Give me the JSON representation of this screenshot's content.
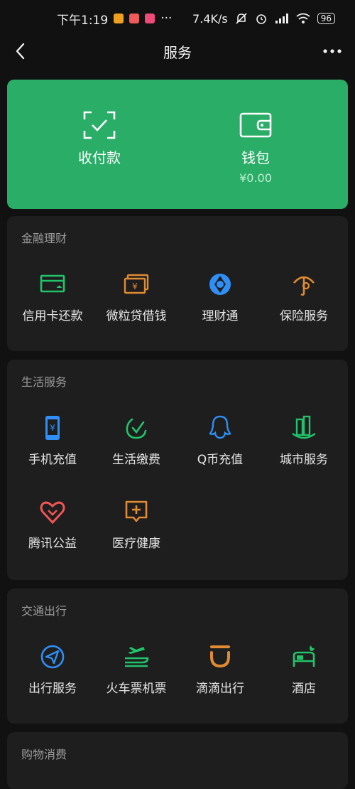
{
  "status_bar": {
    "time": "下午1:19",
    "network_speed": "7.4K/s",
    "battery": "96",
    "more": "···"
  },
  "header": {
    "title": "服务"
  },
  "wallet_card": {
    "pay": {
      "label": "收付款",
      "icon": "scan-check-icon"
    },
    "wallet": {
      "label": "钱包",
      "balance": "¥0.00",
      "icon": "wallet-icon"
    }
  },
  "sections": {
    "finance": {
      "title": "金融理财",
      "items": [
        {
          "label": "信用卡还款",
          "icon": "credit-card-icon"
        },
        {
          "label": "微粒贷借钱",
          "icon": "cash-icon"
        },
        {
          "label": "理财通",
          "icon": "wealth-icon"
        },
        {
          "label": "保险服务",
          "icon": "insurance-icon"
        }
      ]
    },
    "life": {
      "title": "生活服务",
      "items": [
        {
          "label": "手机充值",
          "icon": "phone-icon"
        },
        {
          "label": "生活缴费",
          "icon": "utility-icon"
        },
        {
          "label": "Q币充值",
          "icon": "qq-icon"
        },
        {
          "label": "城市服务",
          "icon": "city-icon"
        },
        {
          "label": "腾讯公益",
          "icon": "charity-icon"
        },
        {
          "label": "医疗健康",
          "icon": "medical-icon"
        }
      ]
    },
    "travel": {
      "title": "交通出行",
      "items": [
        {
          "label": "出行服务",
          "icon": "navigation-icon"
        },
        {
          "label": "火车票机票",
          "icon": "train-icon"
        },
        {
          "label": "滴滴出行",
          "icon": "didi-icon"
        },
        {
          "label": "酒店",
          "icon": "hotel-icon"
        }
      ]
    },
    "shopping": {
      "title": "购物消费"
    }
  },
  "colors": {
    "green_card": "#2aae67",
    "green_icon": "#21c46a",
    "blue_icon": "#2f8ff5",
    "orange_icon": "#e08a32",
    "red_icon": "#f05555"
  }
}
